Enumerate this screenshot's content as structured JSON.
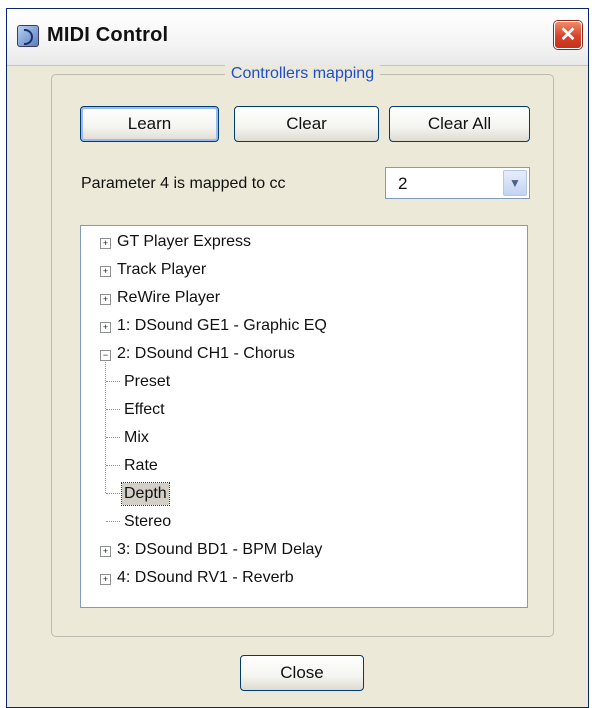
{
  "window": {
    "title": "MIDI Control",
    "close_glyph": "✕",
    "icon": "midi-app-icon"
  },
  "group": {
    "label": "Controllers mapping"
  },
  "buttons": {
    "learn": "Learn",
    "clear": "Clear",
    "clear_all": "Clear All",
    "close": "Close"
  },
  "mapping": {
    "text": "Parameter 4 is mapped to cc",
    "cc_value": "2",
    "dropdown_glyph": "▼"
  },
  "tree": {
    "nodes": [
      {
        "label": "GT Player Express",
        "expander": "+"
      },
      {
        "label": "Track Player",
        "expander": "+"
      },
      {
        "label": "ReWire Player",
        "expander": "+"
      },
      {
        "label": "1: DSound GE1 - Graphic EQ",
        "expander": "+"
      },
      {
        "label": "2: DSound CH1 - Chorus",
        "expander": "−",
        "expanded": true,
        "children": [
          "Preset",
          "Effect",
          "Mix",
          "Rate",
          "Depth",
          "Stereo"
        ],
        "selected_child": "Depth"
      },
      {
        "label": "3: DSound BD1 - BPM Delay",
        "expander": "+"
      },
      {
        "label": "4: DSound RV1 - Reverb",
        "expander": "+"
      }
    ]
  },
  "colors": {
    "group_label": "#1f4ecc",
    "close_button": "#d7432a",
    "window_bg": "#ece9d8"
  }
}
